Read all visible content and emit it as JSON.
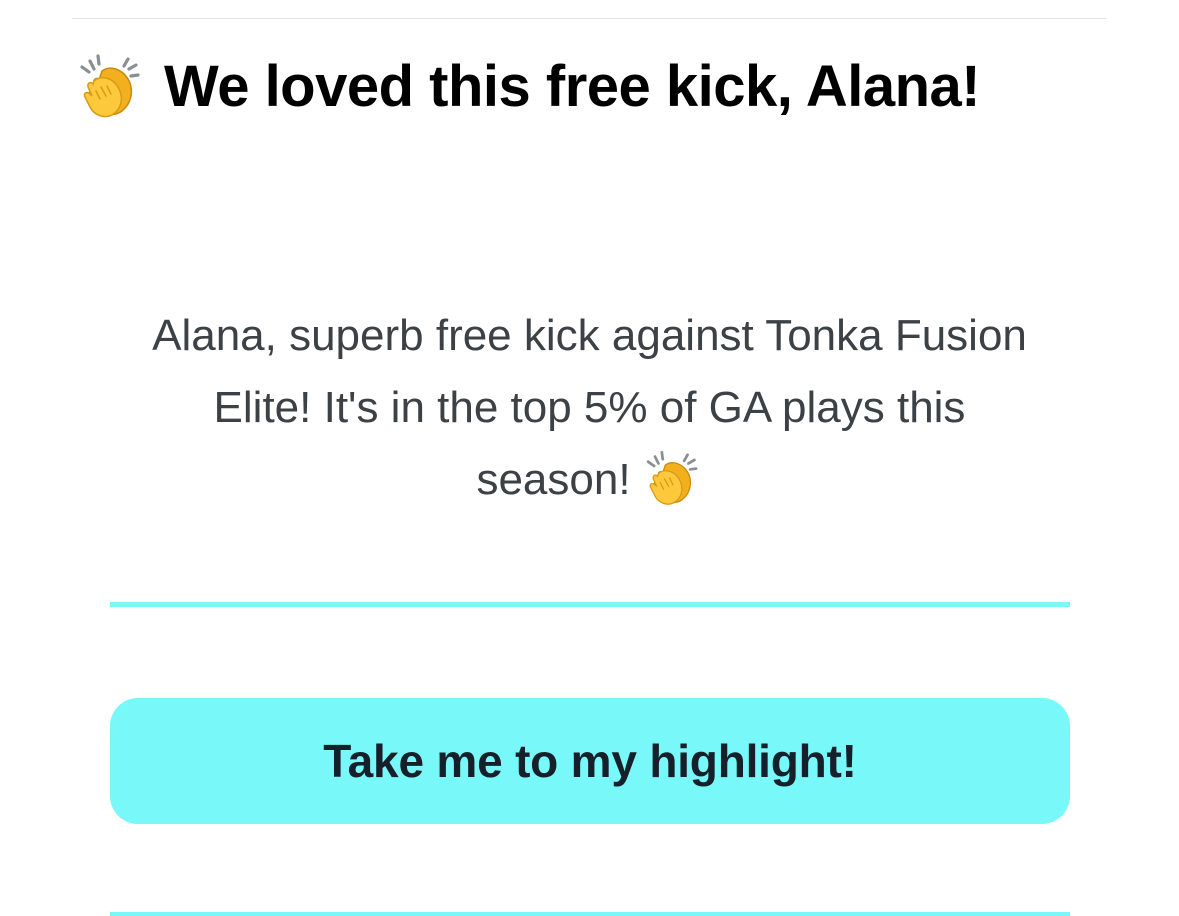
{
  "email": {
    "subject_icon": "clapping-hands-icon",
    "subject": "We loved this free kick, Alana!",
    "message_lines": [
      "Alana, superb free kick against Tonka Fusion",
      "Elite! It's in the top 5% of GA plays this",
      "season!"
    ],
    "message_icon": "clapping-hands-icon",
    "cta_label": "Take me to my highlight!"
  },
  "colors": {
    "accent": "#78f8f8",
    "divider": "#e6e6e6",
    "title_text": "#000000",
    "body_text": "#3c4146",
    "button_text": "#15202b"
  }
}
